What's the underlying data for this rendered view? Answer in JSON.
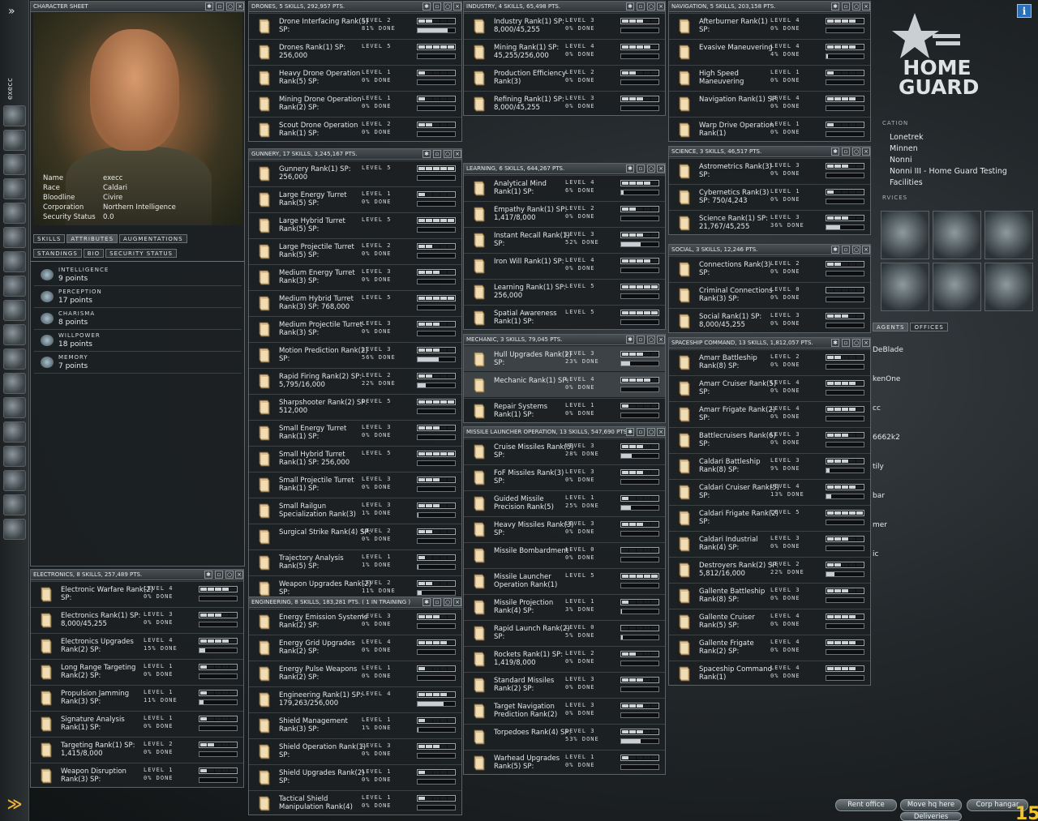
{
  "nav": {
    "pilot": "execc",
    "chevron": "»"
  },
  "character": {
    "title": "CHARACTER SHEET",
    "info": [
      [
        "Name",
        "execc"
      ],
      [
        "Race",
        "Caldari"
      ],
      [
        "Bloodline",
        "Civire"
      ],
      [
        "Corporation",
        "Northern Intelligence"
      ],
      [
        "Security Status",
        "0.0"
      ]
    ],
    "tabs1": [
      "SKILLS",
      "ATTRIBUTES",
      "AUGMENTATIONS"
    ],
    "tabs2": [
      "STANDINGS",
      "BIO",
      "SECURITY STATUS"
    ],
    "attributes": [
      {
        "name": "INTELLIGENCE",
        "value": "9 points"
      },
      {
        "name": "PERCEPTION",
        "value": "17 points"
      },
      {
        "name": "CHARISMA",
        "value": "8 points"
      },
      {
        "name": "WILLPOWER",
        "value": "18 points"
      },
      {
        "name": "MEMORY",
        "value": "7 points"
      }
    ]
  },
  "groups": [
    {
      "title": "DRONES, 5 SKILLS, 292,957 PTS.",
      "skills": [
        [
          "Drone Interfacing Rank(5) SP:",
          "LEVEL 2",
          "81% DONE",
          2,
          81
        ],
        [
          "Drones Rank(1) SP: 256,000",
          "LEVEL 5",
          "",
          5,
          0
        ],
        [
          "Heavy Drone Operation Rank(5) SP:",
          "LEVEL 1",
          "0% DONE",
          1,
          0
        ],
        [
          "Mining Drone Operation Rank(2) SP:",
          "LEVEL 1",
          "0% DONE",
          1,
          0
        ],
        [
          "Scout Drone Operation Rank(1) SP:",
          "LEVEL 2",
          "0% DONE",
          2,
          0
        ]
      ]
    },
    {
      "title": "GUNNERY, 17 SKILLS, 3,245,167 PTS.",
      "skills": [
        [
          "Gunnery Rank(1) SP: 256,000",
          "LEVEL 5",
          "",
          5,
          0
        ],
        [
          "Large Energy Turret Rank(5) SP:",
          "LEVEL 1",
          "0% DONE",
          1,
          0
        ],
        [
          "Large Hybrid Turret Rank(5) SP:",
          "LEVEL 5",
          "",
          5,
          0
        ],
        [
          "Large Projectile Turret Rank(5) SP:",
          "LEVEL 2",
          "0% DONE",
          2,
          0
        ],
        [
          "Medium Energy Turret Rank(3) SP:",
          "LEVEL 3",
          "0% DONE",
          3,
          0
        ],
        [
          "Medium Hybrid Turret Rank(3) SP: 768,000",
          "LEVEL 5",
          "",
          5,
          0
        ],
        [
          "Medium Projectile Turret Rank(3) SP:",
          "LEVEL 3",
          "0% DONE",
          3,
          0
        ],
        [
          "Motion Prediction Rank(2) SP:",
          "LEVEL 3",
          "56% DONE",
          3,
          56
        ],
        [
          "Rapid Firing Rank(2) SP: 5,795/16,000",
          "LEVEL 2",
          "22% DONE",
          2,
          22
        ],
        [
          "Sharpshooter Rank(2) SP: 512,000",
          "LEVEL 5",
          "",
          5,
          0
        ],
        [
          "Small Energy Turret Rank(1) SP:",
          "LEVEL 3",
          "0% DONE",
          3,
          0
        ],
        [
          "Small Hybrid Turret Rank(1) SP: 256,000",
          "LEVEL 5",
          "",
          5,
          0
        ],
        [
          "Small Projectile Turret Rank(1) SP:",
          "LEVEL 3",
          "0% DONE",
          3,
          0
        ],
        [
          "Small Railgun Specialization Rank(3)",
          "LEVEL 3",
          "1% DONE",
          3,
          1
        ],
        [
          "Surgical Strike Rank(4) SP:",
          "LEVEL 2",
          "0% DONE",
          2,
          0
        ],
        [
          "Trajectory Analysis Rank(5) SP:",
          "LEVEL 1",
          "1% DONE",
          1,
          1
        ],
        [
          "Weapon Upgrades Rank(2) SP:",
          "LEVEL 2",
          "11% DONE",
          2,
          11
        ]
      ]
    },
    {
      "title": "ENGINEERING, 8 SKILLS, 183,281 PTS. ( 1 IN TRAINING )",
      "skills": [
        [
          "Energy Emission Systems Rank(2) SP:",
          "LEVEL 3",
          "0% DONE",
          3,
          0
        ],
        [
          "Energy Grid Upgrades Rank(2) SP:",
          "LEVEL 4",
          "0% DONE",
          4,
          0
        ],
        [
          "Energy Pulse Weapons Rank(2) SP:",
          "LEVEL 1",
          "0% DONE",
          1,
          0
        ],
        [
          "Engineering Rank(1) SP: 179,263/256,000",
          "LEVEL 4",
          "",
          4,
          70
        ],
        [
          "Shield Management Rank(3) SP:",
          "LEVEL 1",
          "1% DONE",
          1,
          1
        ],
        [
          "Shield Operation Rank(1) SP:",
          "LEVEL 3",
          "0% DONE",
          3,
          0
        ],
        [
          "Shield Upgrades Rank(2) SP:",
          "LEVEL 1",
          "0% DONE",
          1,
          0
        ],
        [
          "Tactical Shield Manipulation Rank(4)",
          "LEVEL 1",
          "0% DONE",
          1,
          0
        ]
      ]
    },
    {
      "title": "ELECTRONICS, 8 SKILLS, 257,489 PTS.",
      "skills": [
        [
          "Electronic Warfare Rank(2) SP:",
          "LEVEL 4",
          "0% DONE",
          4,
          0
        ],
        [
          "Electronics Rank(1) SP: 8,000/45,255",
          "LEVEL 3",
          "0% DONE",
          3,
          0
        ],
        [
          "Electronics Upgrades Rank(2) SP:",
          "LEVEL 4",
          "15% DONE",
          4,
          15
        ],
        [
          "Long Range Targeting Rank(2) SP:",
          "LEVEL 1",
          "0% DONE",
          1,
          0
        ],
        [
          "Propulsion Jamming Rank(3) SP:",
          "LEVEL 1",
          "11% DONE",
          1,
          11
        ],
        [
          "Signature Analysis Rank(1) SP:",
          "LEVEL 1",
          "0% DONE",
          1,
          0
        ],
        [
          "Targeting Rank(1) SP: 1,415/8,000",
          "LEVEL 2",
          "0% DONE",
          2,
          0
        ],
        [
          "Weapon Disruption Rank(3) SP:",
          "LEVEL 1",
          "0% DONE",
          1,
          0
        ]
      ]
    },
    {
      "title": "INDUSTRY, 4 SKILLS, 65,498 PTS.",
      "skills": [
        [
          "Industry Rank(1) SP: 8,000/45,255",
          "LEVEL 3",
          "0% DONE",
          3,
          0
        ],
        [
          "Mining Rank(1) SP: 45,255/256,000",
          "LEVEL 4",
          "0% DONE",
          4,
          0
        ],
        [
          "Production Efficiency Rank(3)",
          "LEVEL 2",
          "0% DONE",
          2,
          0
        ],
        [
          "Refining Rank(1) SP: 8,000/45,255",
          "LEVEL 3",
          "0% DONE",
          3,
          0
        ]
      ]
    },
    {
      "title": "LEARNING, 6 SKILLS, 644,267 PTS.",
      "skills": [
        [
          "Analytical Mind Rank(1) SP:",
          "LEVEL 4",
          "6% DONE",
          4,
          6
        ],
        [
          "Empathy Rank(1) SP: 1,417/8,000",
          "LEVEL 2",
          "0% DONE",
          2,
          0
        ],
        [
          "Instant Recall Rank(1) SP:",
          "LEVEL 3",
          "52% DONE",
          3,
          52
        ],
        [
          "Iron Will Rank(1) SP:",
          "LEVEL 4",
          "0% DONE",
          4,
          0
        ],
        [
          "Learning Rank(1) SP: 256,000",
          "LEVEL 5",
          "",
          5,
          0
        ],
        [
          "Spatial Awareness Rank(1) SP:",
          "LEVEL 5",
          "",
          5,
          0
        ]
      ]
    },
    {
      "title": "MECHANIC, 3 SKILLS, 79,045 PTS.",
      "skills": [
        [
          "Hull Upgrades Rank(2) SP:",
          "LEVEL 3",
          "23% DONE",
          3,
          23,
          true
        ],
        [
          "Mechanic Rank(1) SP:",
          "LEVEL 4",
          "0% DONE",
          4,
          0,
          true
        ],
        [
          "Repair Systems Rank(1) SP:",
          "LEVEL 1",
          "0% DONE",
          1,
          0
        ]
      ]
    },
    {
      "title": "MISSILE LAUNCHER OPERATION, 13 SKILLS, 547,690 PTS.",
      "skills": [
        [
          "Cruise Missiles Rank(5) SP:",
          "LEVEL 3",
          "28% DONE",
          3,
          28
        ],
        [
          "FoF Missiles Rank(3) SP:",
          "LEVEL 3",
          "0% DONE",
          3,
          0
        ],
        [
          "Guided Missile Precision Rank(5)",
          "LEVEL 1",
          "25% DONE",
          1,
          25
        ],
        [
          "Heavy Missiles Rank(3) SP:",
          "LEVEL 3",
          "0% DONE",
          3,
          0
        ],
        [
          "Missile Bombardment",
          "LEVEL 0",
          "0% DONE",
          0,
          0
        ],
        [
          "Missile Launcher Operation Rank(1)",
          "LEVEL 5",
          "",
          5,
          0
        ],
        [
          "Missile Projection Rank(4) SP:",
          "LEVEL 1",
          "3% DONE",
          1,
          3
        ],
        [
          "Rapid Launch Rank(2) SP:",
          "LEVEL 0",
          "5% DONE",
          0,
          5
        ],
        [
          "Rockets Rank(1) SP: 1,419/8,000",
          "LEVEL 2",
          "0% DONE",
          2,
          0
        ],
        [
          "Standard Missiles Rank(2) SP:",
          "LEVEL 3",
          "0% DONE",
          3,
          0
        ],
        [
          "Target Navigation Prediction Rank(2)",
          "LEVEL 3",
          "0% DONE",
          3,
          0
        ],
        [
          "Torpedoes Rank(4) SP:",
          "LEVEL 3",
          "53% DONE",
          3,
          53
        ],
        [
          "Warhead Upgrades Rank(5) SP:",
          "LEVEL 1",
          "0% DONE",
          1,
          0
        ]
      ]
    },
    {
      "title": "NAVIGATION, 5 SKILLS, 203,158 PTS.",
      "skills": [
        [
          "Afterburner Rank(1) SP:",
          "LEVEL 4",
          "0% DONE",
          4,
          0
        ],
        [
          "Evasive Maneuvering",
          "LEVEL 4",
          "4% DONE",
          4,
          4
        ],
        [
          "High Speed Maneuvering",
          "LEVEL 1",
          "0% DONE",
          1,
          0
        ],
        [
          "Navigation Rank(1) SP:",
          "LEVEL 4",
          "0% DONE",
          4,
          0
        ],
        [
          "Warp Drive Operation Rank(1)",
          "LEVEL 1",
          "0% DONE",
          1,
          0
        ]
      ]
    },
    {
      "title": "SCIENCE, 3 SKILLS, 46,517 PTS.",
      "skills": [
        [
          "Astrometrics Rank(3) SP:",
          "LEVEL 3",
          "0% DONE",
          3,
          0
        ],
        [
          "Cybernetics Rank(3) SP: 750/4,243",
          "LEVEL 1",
          "0% DONE",
          1,
          0
        ],
        [
          "Science Rank(1) SP: 21,767/45,255",
          "LEVEL 3",
          "36% DONE",
          3,
          36
        ]
      ]
    },
    {
      "title": "SOCIAL, 3 SKILLS, 12,246 PTS.",
      "skills": [
        [
          "Connections Rank(3) SP:",
          "LEVEL 2",
          "0% DONE",
          2,
          0
        ],
        [
          "Criminal Connections Rank(3) SP:",
          "LEVEL 0",
          "0% DONE",
          0,
          0
        ],
        [
          "Social Rank(1) SP: 8,000/45,255",
          "LEVEL 3",
          "0% DONE",
          3,
          0
        ]
      ]
    },
    {
      "title": "SPACESHIP COMMAND, 13 SKILLS, 1,812,057 PTS.",
      "skills": [
        [
          "Amarr Battleship Rank(8) SP:",
          "LEVEL 2",
          "0% DONE",
          2,
          0
        ],
        [
          "Amarr Cruiser Rank(5) SP:",
          "LEVEL 4",
          "0% DONE",
          4,
          0
        ],
        [
          "Amarr Frigate Rank(2) SP:",
          "LEVEL 4",
          "0% DONE",
          4,
          0
        ],
        [
          "Battlecruisers Rank(6) SP:",
          "LEVEL 3",
          "0% DONE",
          3,
          0
        ],
        [
          "Caldari Battleship Rank(8) SP:",
          "LEVEL 3",
          "9% DONE",
          3,
          9
        ],
        [
          "Caldari Cruiser Rank(5) SP:",
          "LEVEL 4",
          "13% DONE",
          4,
          13
        ],
        [
          "Caldari Frigate Rank(2) SP:",
          "LEVEL 5",
          "",
          5,
          0
        ],
        [
          "Caldari Industrial Rank(4) SP:",
          "LEVEL 3",
          "0% DONE",
          3,
          0
        ],
        [
          "Destroyers Rank(2) SP: 5,812/16,000",
          "LEVEL 2",
          "22% DONE",
          2,
          22
        ],
        [
          "Gallente Battleship Rank(8) SP:",
          "LEVEL 3",
          "0% DONE",
          3,
          0
        ],
        [
          "Gallente Cruiser Rank(5) SP:",
          "LEVEL 4",
          "0% DONE",
          4,
          0
        ],
        [
          "Gallente Frigate Rank(2) SP:",
          "LEVEL 4",
          "0% DONE",
          4,
          0
        ],
        [
          "Spaceship Command Rank(1)",
          "LEVEL 4",
          "0% DONE",
          4,
          0
        ]
      ]
    }
  ],
  "station": {
    "logo": "HOME GUARD",
    "section_location": "CATION",
    "locations": [
      "Lonetrek",
      "Minnen",
      "Nonni",
      "Nonni III - Home Guard Testing",
      "Facilities"
    ],
    "section_services": "RVICES",
    "tabs": [
      "AGENTS",
      "OFFICES"
    ],
    "agents": [
      "DeBlade",
      "kenOne",
      "cc",
      "6662k2",
      "tily",
      "bar",
      "mer",
      "ic"
    ],
    "buttons": [
      "Rent office",
      "Move hq here",
      "Corp hangar",
      "Deliveries"
    ],
    "corner": "15",
    "info_icon": "i"
  }
}
